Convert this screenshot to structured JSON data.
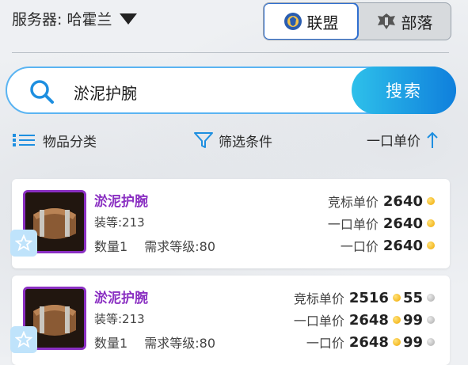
{
  "header": {
    "server_label": "服务器: 哈霍兰",
    "faction_alliance": "联盟",
    "faction_horde": "部落"
  },
  "search": {
    "query": "淤泥护腕",
    "button_label": "搜索"
  },
  "filters": {
    "category": "物品分类",
    "conditions": "筛选条件",
    "sort": "一口单价"
  },
  "items": [
    {
      "name": "淤泥护腕",
      "item_level": "装等:213",
      "quantity": "数量1",
      "required_level": "需求等级:80",
      "bid_label": "竞标单价",
      "bid_gold": "2640",
      "bid_silver": "",
      "buyout_unit_label": "一口单价",
      "buyout_unit_gold": "2640",
      "buyout_unit_silver": "",
      "buyout_label": "一口价",
      "buyout_gold": "2640",
      "buyout_silver": ""
    },
    {
      "name": "淤泥护腕",
      "item_level": "装等:213",
      "quantity": "数量1",
      "required_level": "需求等级:80",
      "bid_label": "竞标单价",
      "bid_gold": "2516",
      "bid_silver": "55",
      "buyout_unit_label": "一口单价",
      "buyout_unit_gold": "2648",
      "buyout_unit_silver": "99",
      "buyout_label": "一口价",
      "buyout_gold": "2648",
      "buyout_silver": "99"
    }
  ],
  "colors": {
    "accent_blue": "#1e90e8",
    "epic_purple": "#8a2fc2",
    "gold": "#f0a800"
  },
  "icons": [
    "caret-down-icon",
    "alliance-crest-icon",
    "horde-crest-icon",
    "search-icon",
    "list-icon",
    "funnel-icon",
    "arrow-up-icon",
    "star-icon",
    "gold-coin-icon",
    "silver-coin-icon"
  ]
}
